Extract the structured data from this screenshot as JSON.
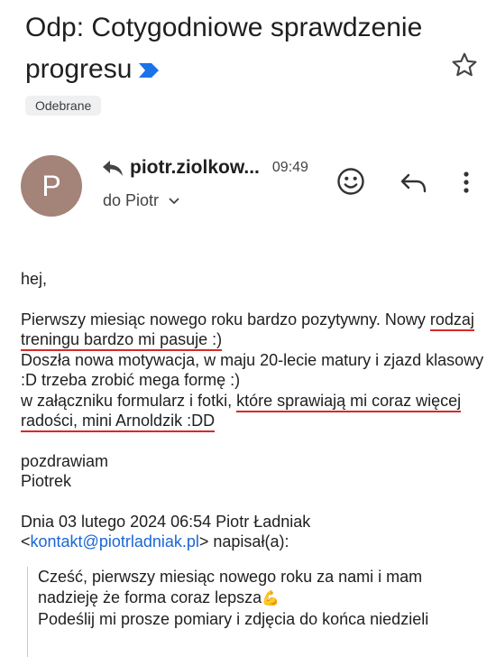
{
  "email": {
    "subject": "Odp: Cotygodniowe sprawdzenie progresu",
    "label": "Odebrane",
    "avatar_letter": "P",
    "sender": "piotr.ziolkow...",
    "time": "09:49",
    "to": "do Piotr"
  },
  "body": {
    "greeting": "hej,",
    "p1_start": "Pierwszy miesiąc nowego roku bardzo pozytywny. Nowy",
    "p1_underlined": "rodzaj treningu bardzo mi pasuje :)",
    "p1_rest": "Doszła nowa motywacja, w maju 20-lecie matury i zjazd klasowy :D trzeba zrobić mega formę :)",
    "p1_attach": "w załączniku formularz i fotki, ",
    "p1_underlined2": "które sprawiają mi coraz więcej radości,  mini Arnoldzik :DD",
    "sign1": "pozdrawiam",
    "sign2": "Piotrek",
    "quote_header_1": "Dnia 03 lutego 2024 06:54 Piotr Ładniak",
    "quote_lt": "<",
    "quote_email": "kontakt@piotrladniak.pl",
    "quote_header_2": "> napisał(a):"
  },
  "quote": {
    "line1": "Cześć, pierwszy miesiąc nowego roku za nami i mam",
    "line2": "nadzieję że  forma coraz lepsza",
    "emoji": "💪",
    "line3": "Podeślij mi prosze pomiary i zdjęcia do końca niedzieli"
  },
  "colors": {
    "accent": "#1a66d6",
    "importance": "#1a73e8",
    "underline": "#d42a2a",
    "avatar": "#a48379"
  }
}
